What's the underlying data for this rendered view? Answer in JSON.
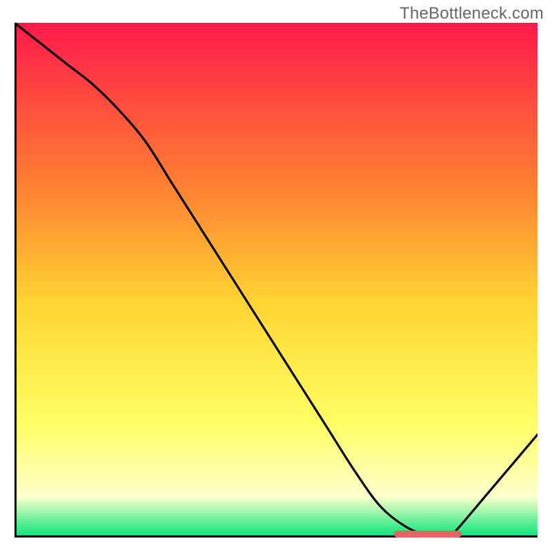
{
  "watermark": "TheBottleneck.com",
  "colors": {
    "gradient_top": "#ff1a4b",
    "gradient_mid_upper": "#ff7a33",
    "gradient_mid": "#ffd633",
    "gradient_mid_lower": "#ffff66",
    "gradient_lower": "#ffffcc",
    "gradient_bottom": "#00e676",
    "axis": "#000000",
    "curve": "#000000",
    "red_bar": "#e06666"
  },
  "chart_data": {
    "type": "line",
    "title": "",
    "xlabel": "",
    "ylabel": "",
    "xlim": [
      0,
      100
    ],
    "ylim": [
      0,
      100
    ],
    "grid": false,
    "legend": false,
    "series": [
      {
        "name": "curve",
        "x": [
          0,
          5,
          10,
          15,
          20,
          25,
          30,
          35,
          40,
          45,
          50,
          55,
          60,
          65,
          70,
          75,
          80,
          81.5,
          83,
          85,
          90,
          95,
          100
        ],
        "values": [
          100,
          96,
          92,
          88,
          83,
          77,
          69,
          61,
          53,
          45,
          37,
          29,
          21,
          13,
          6,
          2,
          0,
          0,
          0,
          2,
          8,
          14,
          20
        ]
      }
    ],
    "annotations": [
      {
        "name": "minimum-highlight-bar",
        "x_center": 79,
        "width_x_units": 13,
        "y": 0.7,
        "color": "#e06666"
      }
    ]
  }
}
